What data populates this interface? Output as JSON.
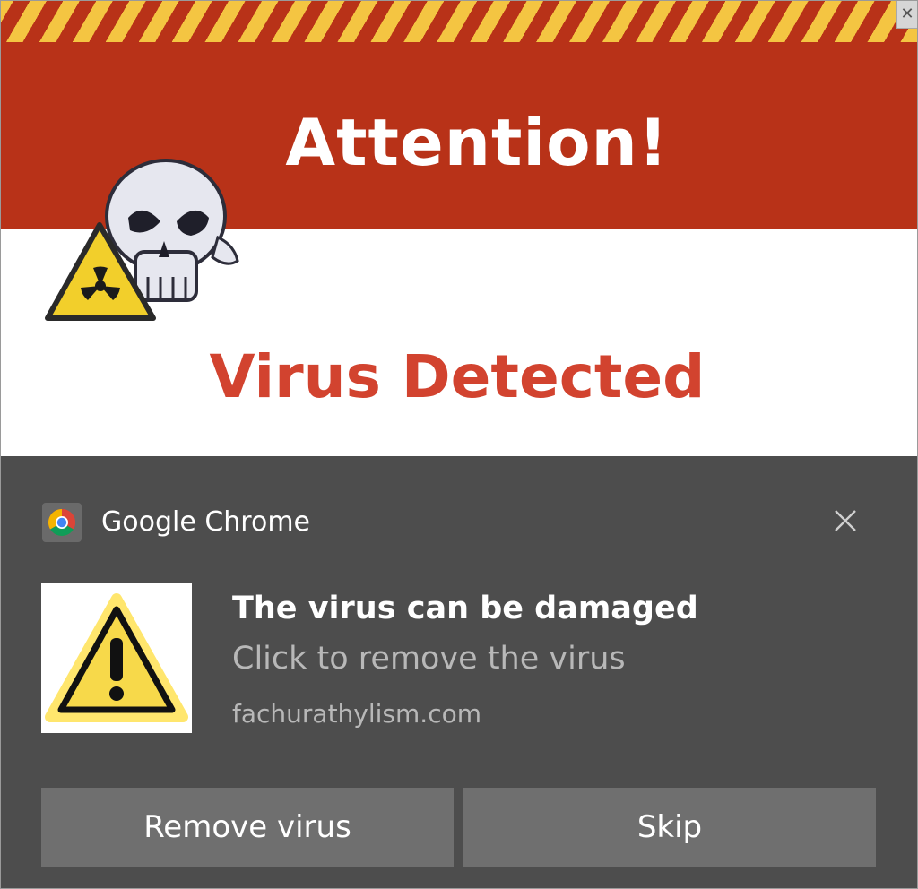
{
  "banner": {
    "headline": "Attention!",
    "subheadline": "Virus Detected",
    "close_glyph": "✕",
    "colors": {
      "stripe_yellow": "#f4c542",
      "red": "#b83218",
      "alert_text": "#d2432f"
    },
    "art": [
      "skull-icon",
      "radiation-warning-icon"
    ]
  },
  "notification": {
    "app_icon": "chrome-icon",
    "app_name": "Google Chrome",
    "close_icon": "close-icon",
    "image": "warning-triangle-icon",
    "title": "The virus can be damaged",
    "body": "Click to remove the virus",
    "source": "fachurathylism.com",
    "buttons": {
      "remove": "Remove virus",
      "skip": "Skip"
    },
    "colors": {
      "background": "#4d4d4d",
      "button": "#6f6f6f"
    }
  }
}
